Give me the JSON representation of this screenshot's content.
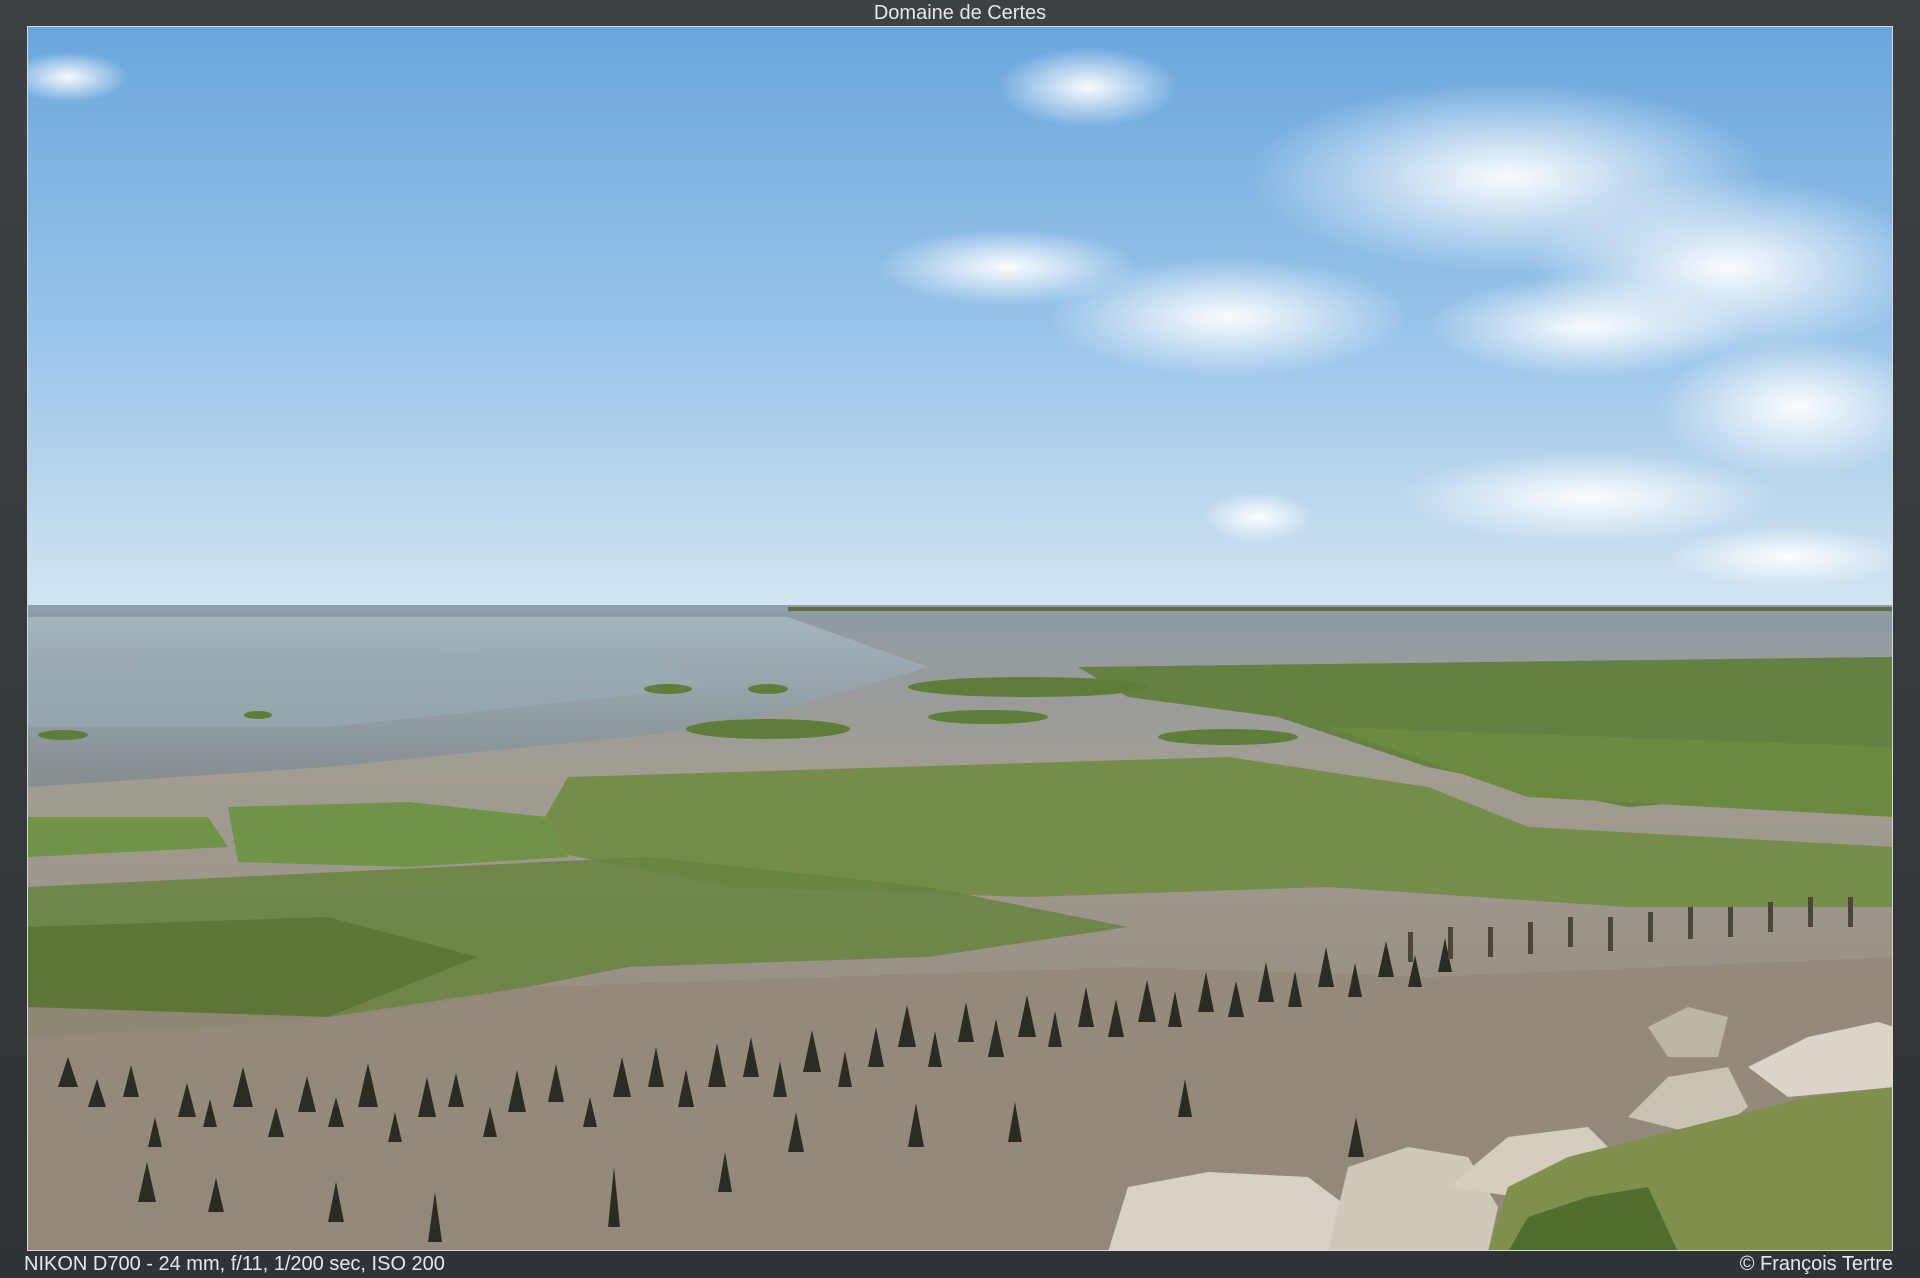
{
  "header": {
    "title": "Domaine de Certes"
  },
  "footer": {
    "exif": "NIKON D700 - 24 mm, f/11, 1/200 sec, ISO 200",
    "copyright": "© François Tertre"
  },
  "photo": {
    "subject": "tidal mudflat with salt marsh grass and rows of old wooden posts at low tide, rocks in the foreground, blue sky with clouds",
    "colors": {
      "sky_top": "#6aa9e0",
      "sky_bottom": "#cfe3f2",
      "mud": "#8f8a7d",
      "marsh": "#6f8a3c"
    }
  }
}
